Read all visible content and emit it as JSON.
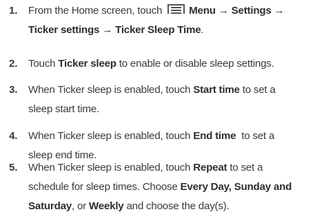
{
  "steps": [
    {
      "number": "1.",
      "lines": [
        {
          "pre": "From the Home screen, touch ",
          "icon": "menu-icon",
          "bold_menu": "Menu",
          "arrow1": " → ",
          "bold_settings": "Settings",
          "arrow2": " →"
        },
        {
          "bold_ticker_settings": "Ticker settings",
          "arrow3": " → ",
          "bold_ticker_sleep_time": "Ticker Sleep Time",
          "end": "."
        }
      ]
    },
    {
      "number": "2.",
      "pre": "Touch ",
      "bold": "Ticker sleep",
      "post": " to enable or disable sleep settings."
    },
    {
      "number": "3.",
      "line1_pre": "When Ticker sleep is enabled, touch ",
      "line1_bold": "Start time",
      "line1_post": " to set a",
      "line2": "sleep start time."
    },
    {
      "number": "4.",
      "line1_pre": "When Ticker sleep is enabled, touch ",
      "line1_bold": "End time",
      "line1_post": "  to set a",
      "line2": "sleep end time."
    },
    {
      "number": "5.",
      "line1_pre": "When Ticker sleep is enabled, touch ",
      "line1_bold": "Repeat",
      "line1_post": " to set a",
      "line2_pre": "schedule for sleep times. Choose ",
      "line2_bold1": "Every Day",
      "line2_mid": ", ",
      "line2_bold2": "Sunday and",
      "line3_bold": "Saturday",
      "line3_mid": ", or ",
      "line3_bold2": "Weekly",
      "line3_post": " and choose the day(s)."
    }
  ]
}
